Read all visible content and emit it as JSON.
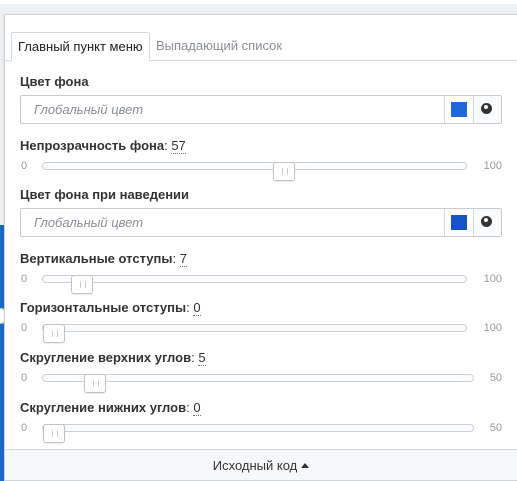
{
  "tabs": [
    {
      "label": "Главный пункт меню"
    },
    {
      "label": "Выпадающий список"
    }
  ],
  "fields": {
    "bg_color": {
      "label": "Цвет фона",
      "placeholder": "Глобальный цвет",
      "swatch_color": "#1e69d9"
    },
    "bg_opacity": {
      "label": "Непрозрачность фона",
      "value": "57",
      "min": "0",
      "max": "100"
    },
    "hover_bg_color": {
      "label": "Цвет фона при наведении",
      "placeholder": "Глобальный цвет",
      "swatch_color": "#1553c7"
    },
    "vertical_padding": {
      "label": "Вертикальные отступы",
      "value": "7",
      "min": "0",
      "max": "100"
    },
    "horizontal_padding": {
      "label": "Горизонтальные отступы",
      "value": "0",
      "min": "0",
      "max": "100"
    },
    "top_radius": {
      "label": "Скругление верхних углов",
      "value": "5",
      "min": "0",
      "max": "50"
    },
    "bottom_radius": {
      "label": "Скругление нижних углов",
      "value": "0",
      "min": "0",
      "max": "50"
    }
  },
  "footer": {
    "label": "Исходный код"
  }
}
